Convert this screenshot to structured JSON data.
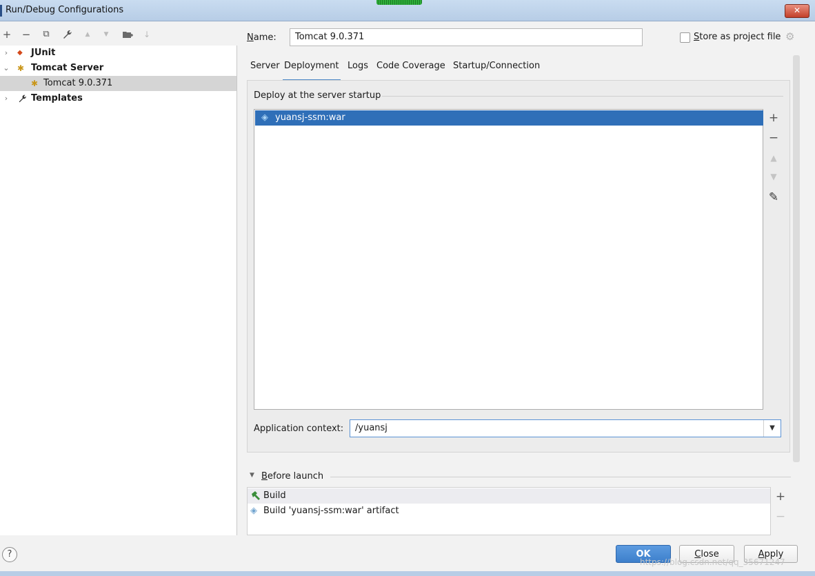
{
  "window": {
    "title": "Run/Debug Configurations",
    "close_glyph": "✕"
  },
  "toolbar": {
    "add": "+",
    "remove": "−",
    "copy": "⧉",
    "edit": "🔧",
    "up": "▲",
    "down": "▼",
    "folder": "▮",
    "sort": "↓"
  },
  "tree": {
    "items": [
      {
        "label": "JUnit",
        "arrow": "›",
        "icon": "junit-icon",
        "level": 0
      },
      {
        "label": "Tomcat Server",
        "arrow": "⌄",
        "icon": "tomcat-icon",
        "level": 0
      },
      {
        "label": "Tomcat 9.0.371",
        "icon": "tomcat-icon",
        "level": 1,
        "selected": true
      },
      {
        "label": "Templates",
        "arrow": "›",
        "icon": "wrench-icon",
        "level": 0
      }
    ]
  },
  "form": {
    "name_label_access": "N",
    "name_label_rest": "ame:",
    "name_value": "Tomcat 9.0.371",
    "store_label_access": "S",
    "store_label_rest": "tore as project file",
    "store_checked": false
  },
  "tabs": [
    {
      "label": "Server"
    },
    {
      "label": "Deployment",
      "active": true
    },
    {
      "label": "Logs"
    },
    {
      "label": "Code Coverage"
    },
    {
      "label": "Startup/Connection"
    }
  ],
  "deployment": {
    "section_title": "Deploy at the server startup",
    "artifacts": [
      "yuansj-ssm:war"
    ],
    "side_buttons": {
      "add": "+",
      "remove": "−",
      "up": "▲",
      "down": "▼",
      "edit": "✎"
    },
    "context_label": "Application context:",
    "context_value": "/yuansj",
    "dropdown_glyph": "▼"
  },
  "before_launch": {
    "title_access": "B",
    "title_rest": "efore launch",
    "items": [
      "Build",
      "Build 'yuansj-ssm:war' artifact"
    ],
    "add": "+",
    "remove": "−"
  },
  "buttons": {
    "help": "?",
    "ok": "OK",
    "close_access": "C",
    "close_rest": "lose",
    "apply_access": "A",
    "apply_rest": "pply"
  },
  "watermark": "https://blog.csdn.net/qq_35671247",
  "colors": {
    "selection": "#2f6fb8",
    "accent": "#4a86c7",
    "primary_button": "#3d7fcb"
  }
}
